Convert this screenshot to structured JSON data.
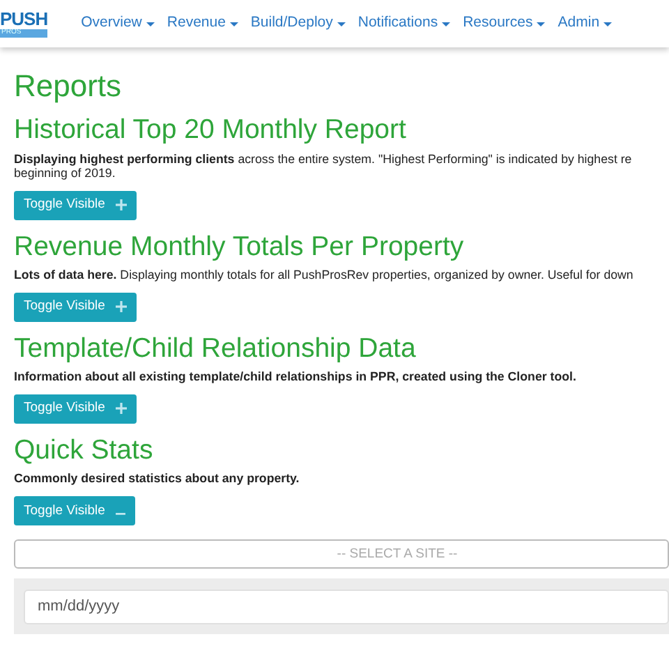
{
  "navbar": {
    "logo": {
      "top": "PUSH",
      "bottom": "PROS"
    },
    "menu": [
      {
        "label": "Overview"
      },
      {
        "label": "Revenue"
      },
      {
        "label": "Build/Deploy"
      },
      {
        "label": "Notifications"
      },
      {
        "label": "Resources"
      },
      {
        "label": "Admin"
      }
    ]
  },
  "page_title": "Reports",
  "sections": [
    {
      "title": "Historical Top 20 Monthly Report",
      "description": [
        "**Displaying highest performing clients** across the entire system. \"Highest Performing\" is indicated by highest re",
        "beginning of 2019."
      ],
      "button": "Toggle Visible",
      "expanded": false
    },
    {
      "title": "Revenue Monthly Totals Per Property",
      "description": [
        "**Lots of data here.** Displaying monthly totals for all PushProsRev properties, organized by owner. Useful for down"
      ],
      "button": "Toggle Visible",
      "expanded": false
    },
    {
      "title": "Template/Child Relationship Data",
      "description": [
        "**Information about all existing template/child relationships in PPR, created using the Cloner tool.**"
      ],
      "button": "Toggle Visible",
      "expanded": false
    },
    {
      "title": "Quick Stats",
      "description": [
        "**Commonly desired statistics about any property.**"
      ],
      "button": "Toggle Visible",
      "expanded": true,
      "site_select": {
        "placeholder": "-- SELECT A SITE --"
      },
      "date_field": {
        "placeholder": "mm/dd/yyyy"
      }
    }
  ]
}
